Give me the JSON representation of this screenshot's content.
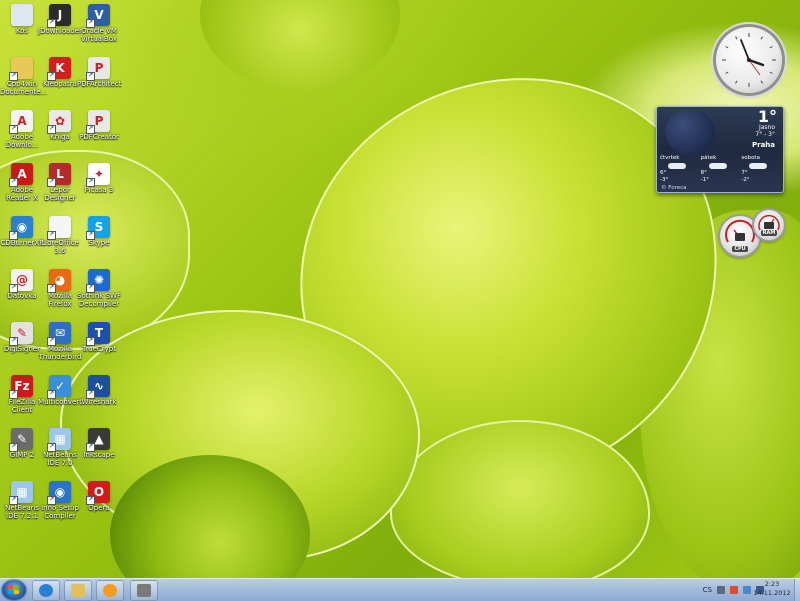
{
  "desktop": {
    "icons": [
      {
        "id": "kos",
        "label": "Koš",
        "glyph": "recycle-bin-icon",
        "color": "#dfe7ee",
        "mark": ""
      },
      {
        "id": "jdownloader",
        "label": "JDownloader",
        "glyph": "jdownloader-icon",
        "color": "#2b2b2b",
        "mark": "J"
      },
      {
        "id": "virtualbox",
        "label": "Oracle VM VirtualBox",
        "glyph": "virtualbox-icon",
        "color": "#2d5fa8",
        "mark": "V"
      },
      {
        "id": "cpp4win",
        "label": "Cpp4win Documente...",
        "glyph": "folder-icon",
        "color": "#e9c85a",
        "mark": ""
      },
      {
        "id": "kleopatra",
        "label": "Kleopatra",
        "glyph": "kleopatra-icon",
        "color": "#d11f1f",
        "mark": "K"
      },
      {
        "id": "pdfarchitect",
        "label": "PDFArchitect",
        "glyph": "pdfarchitect-icon",
        "color": "#e8e8e8",
        "mark": "P"
      },
      {
        "id": "adobe-download",
        "label": "Adobe Downlo...",
        "glyph": "adobe-icon",
        "color": "#f3f3f3",
        "mark": "A"
      },
      {
        "id": "kniga",
        "label": "Kniga",
        "glyph": "ribbon-award-icon",
        "color": "#e8e8e8",
        "mark": "✿"
      },
      {
        "id": "pdfcreator",
        "label": "PDFCreator",
        "glyph": "pdfcreator-icon",
        "color": "#e8e8e8",
        "mark": "P"
      },
      {
        "id": "adobe-reader",
        "label": "Adobe Reader X",
        "glyph": "adobe-reader-icon",
        "color": "#c91a1a",
        "mark": "A"
      },
      {
        "id": "lepor",
        "label": "Lepor Designer",
        "glyph": "lepor-designer-icon",
        "color": "#b72a2a",
        "mark": "L"
      },
      {
        "id": "picasa",
        "label": "Picasa 3",
        "glyph": "picasa-icon",
        "color": "#ffffff",
        "mark": "✦"
      },
      {
        "id": "cdburnerxp",
        "label": "CDBurnerXP",
        "glyph": "cdburnerxp-icon",
        "color": "#2a7fd1",
        "mark": "◉"
      },
      {
        "id": "libreoffice",
        "label": "LibreOffice 3.6",
        "glyph": "libreoffice-icon",
        "color": "#f5f5f5",
        "mark": ""
      },
      {
        "id": "skype",
        "label": "Skype",
        "glyph": "skype-icon",
        "color": "#14a3e8",
        "mark": "S"
      },
      {
        "id": "datovka",
        "label": "Datovka",
        "glyph": "datovka-icon",
        "color": "#f2f2f2",
        "mark": "@"
      },
      {
        "id": "firefox",
        "label": "Mozilla Firefox",
        "glyph": "firefox-icon",
        "color": "#e86a12",
        "mark": "◕"
      },
      {
        "id": "swfdecompiler",
        "label": "Sothink SWF Decompiler",
        "glyph": "swf-decompiler-icon",
        "color": "#1a6ad1",
        "mark": "✺"
      },
      {
        "id": "digisigner",
        "label": "DigiSigner",
        "glyph": "pen-icon",
        "color": "#e2e2e2",
        "mark": "✎"
      },
      {
        "id": "thunderbird",
        "label": "Mozilla Thunderbird",
        "glyph": "thunderbird-icon",
        "color": "#2f6fc1",
        "mark": "✉"
      },
      {
        "id": "truecrypt",
        "label": "TrueCrypt",
        "glyph": "truecrypt-icon",
        "color": "#1d4fb0",
        "mark": "T"
      },
      {
        "id": "filezilla",
        "label": "FileZilla Client",
        "glyph": "filezilla-icon",
        "color": "#c81c1c",
        "mark": "Fz"
      },
      {
        "id": "multiconvert",
        "label": "Multiconvert",
        "glyph": "multiconvert-icon",
        "color": "#3b8fd8",
        "mark": "✓"
      },
      {
        "id": "wireshark",
        "label": "Wireshark",
        "glyph": "wireshark-icon",
        "color": "#1c4f9c",
        "mark": "∿"
      },
      {
        "id": "gimp",
        "label": "GIMP 2",
        "glyph": "gimp-icon",
        "color": "#6b6b6b",
        "mark": "✎"
      },
      {
        "id": "netbeans70",
        "label": "NetBeans IDE 7.0",
        "glyph": "netbeans-icon",
        "color": "#9cc6ea",
        "mark": "▦"
      },
      {
        "id": "inkscape",
        "label": "Inkscape",
        "glyph": "inkscape-icon",
        "color": "#3a3a3a",
        "mark": "▲"
      },
      {
        "id": "netbeans721",
        "label": "NetBeans IDE 7.2.1",
        "glyph": "netbeans-icon",
        "color": "#9cc6ea",
        "mark": "▦"
      },
      {
        "id": "innosetup",
        "label": "Inno Setup Compiler",
        "glyph": "inno-setup-icon",
        "color": "#2a73c9",
        "mark": "◉"
      },
      {
        "id": "opera",
        "label": "Opera",
        "glyph": "opera-icon",
        "color": "#d51a1a",
        "mark": "O"
      }
    ]
  },
  "gadgets": {
    "clock": {
      "time": "2:23"
    },
    "weather": {
      "temperature": "1°",
      "condition": "Jasno",
      "range": "7° - 3°",
      "city": "Praha",
      "days": [
        {
          "name": "čtvrtek",
          "high": "6°",
          "low": "-3°"
        },
        {
          "name": "pátek",
          "high": "8°",
          "low": "-1°"
        },
        {
          "name": "sobota",
          "high": "7°",
          "low": "-2°"
        }
      ],
      "source": "© Foreca"
    },
    "meters": {
      "cpu_label": "CPU",
      "ram_label": "RAM"
    }
  },
  "taskbar": {
    "pinned": [
      {
        "id": "ie",
        "glyph": "internet-explorer-icon",
        "color": "#2a7fd4"
      },
      {
        "id": "explorer",
        "glyph": "explorer-folder-icon",
        "color": "#e3c158"
      },
      {
        "id": "mediaplayer",
        "glyph": "media-player-icon",
        "color": "#f39c1d"
      },
      {
        "id": "gimp",
        "glyph": "gimp-icon",
        "color": "#7a7a7a"
      }
    ],
    "language": "CS",
    "time": "2:23",
    "date": "14.11.2012"
  }
}
